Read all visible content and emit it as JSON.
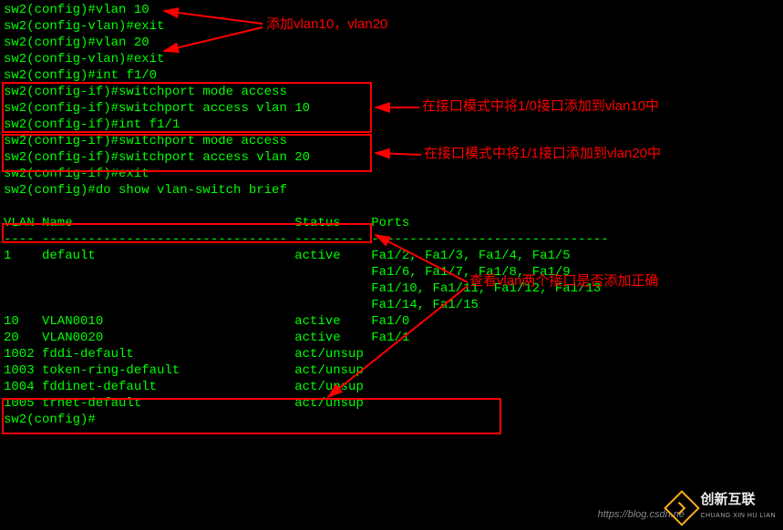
{
  "terminal": {
    "lines": [
      "sw2(config)#vlan 10",
      "sw2(config-vlan)#exit",
      "sw2(config)#vlan 20",
      "sw2(config-vlan)#exit",
      "sw2(config)#int f1/0",
      "sw2(config-if)#switchport mode access",
      "sw2(config-if)#switchport access vlan 10",
      "sw2(config-if)#int f1/1",
      "sw2(config-if)#switchport mode access",
      "sw2(config-if)#switchport access vlan 20",
      "sw2(config-if)#exit",
      "sw2(config)#do show vlan-switch brief",
      "",
      "VLAN Name                             Status    Ports",
      "---- -------------------------------- --------- -------------------------------",
      "1    default                          active    Fa1/2, Fa1/3, Fa1/4, Fa1/5",
      "                                                Fa1/6, Fa1/7, Fa1/8, Fa1/9",
      "                                                Fa1/10, Fa1/11, Fa1/12, Fa1/13",
      "                                                Fa1/14, Fa1/15",
      "10   VLAN0010                         active    Fa1/0",
      "20   VLAN0020                         active    Fa1/1",
      "1002 fddi-default                     act/unsup ",
      "1003 token-ring-default               act/unsup ",
      "1004 fddinet-default                  act/unsup ",
      "1005 trnet-default                    act/unsup ",
      "sw2(config)#"
    ]
  },
  "annotations": {
    "a1": "添加vlan10，vlan20",
    "a2": "在接口模式中将1/0接口添加到vlan10中",
    "a3": "在接口模式中将1/1接口添加到vlan20中",
    "a4": "查看vlan两个接口是否添加正确"
  },
  "watermark": {
    "brand": "创新互联",
    "sub": "CHUANG XIN HU LIAN",
    "url": "https://blog.csdn.ne"
  },
  "chart_data": {
    "type": "table",
    "title": "show vlan-switch brief",
    "columns": [
      "VLAN",
      "Name",
      "Status",
      "Ports"
    ],
    "rows": [
      {
        "VLAN": "1",
        "Name": "default",
        "Status": "active",
        "Ports": "Fa1/2, Fa1/3, Fa1/4, Fa1/5, Fa1/6, Fa1/7, Fa1/8, Fa1/9, Fa1/10, Fa1/11, Fa1/12, Fa1/13, Fa1/14, Fa1/15"
      },
      {
        "VLAN": "10",
        "Name": "VLAN0010",
        "Status": "active",
        "Ports": "Fa1/0"
      },
      {
        "VLAN": "20",
        "Name": "VLAN0020",
        "Status": "active",
        "Ports": "Fa1/1"
      },
      {
        "VLAN": "1002",
        "Name": "fddi-default",
        "Status": "act/unsup",
        "Ports": ""
      },
      {
        "VLAN": "1003",
        "Name": "token-ring-default",
        "Status": "act/unsup",
        "Ports": ""
      },
      {
        "VLAN": "1004",
        "Name": "fddinet-default",
        "Status": "act/unsup",
        "Ports": ""
      },
      {
        "VLAN": "1005",
        "Name": "trnet-default",
        "Status": "act/unsup",
        "Ports": ""
      }
    ]
  }
}
